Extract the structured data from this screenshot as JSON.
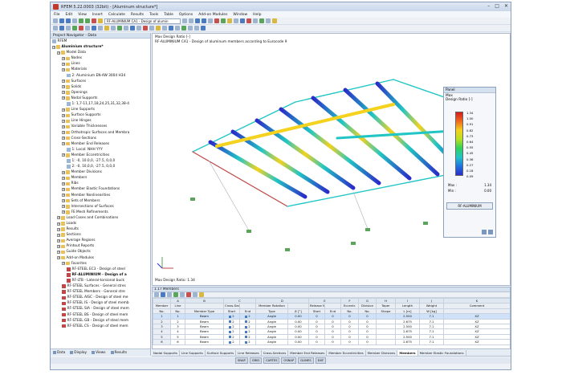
{
  "window": {
    "title": "RFEM 5.22.0003 (32bit) - [Aluminum structure*]"
  },
  "menu": [
    "File",
    "Edit",
    "View",
    "Insert",
    "Calculate",
    "Results",
    "Tools",
    "Table",
    "Options",
    "Add-on Modules",
    "Window",
    "Help"
  ],
  "toolbar": {
    "module_combo": "RF-ALUMINIUM CA1 - Design of alumin"
  },
  "navigator": {
    "header": "Project Navigator - Data",
    "items": [
      {
        "label": "RFEM",
        "level": 0,
        "type": "file"
      },
      {
        "label": "Aluminium structure*",
        "level": 0,
        "type": "folder",
        "bold": true
      },
      {
        "label": "Model Data",
        "level": 1,
        "type": "folder"
      },
      {
        "label": "Nodes",
        "level": 2,
        "type": "folder"
      },
      {
        "label": "Lines",
        "level": 2,
        "type": "folder"
      },
      {
        "label": "Materials",
        "level": 2,
        "type": "folder"
      },
      {
        "label": "2: Aluminium EN-AW 3004 H34",
        "level": 3,
        "type": "file"
      },
      {
        "label": "Surfaces",
        "level": 2,
        "type": "folder"
      },
      {
        "label": "Solids",
        "level": 2,
        "type": "folder"
      },
      {
        "label": "Openings",
        "level": 2,
        "type": "folder"
      },
      {
        "label": "Nodal Supports",
        "level": 2,
        "type": "folder"
      },
      {
        "label": "1: 1,7-11,17,18,24,25,31,32,38-4",
        "level": 3,
        "type": "file"
      },
      {
        "label": "Line Supports",
        "level": 2,
        "type": "folder"
      },
      {
        "label": "Surface Supports",
        "level": 2,
        "type": "folder"
      },
      {
        "label": "Line Hinges",
        "level": 2,
        "type": "folder"
      },
      {
        "label": "Variable Thicknesses",
        "level": 2,
        "type": "folder"
      },
      {
        "label": "Orthotropic Surfaces and Membra",
        "level": 2,
        "type": "folder"
      },
      {
        "label": "Cross-Sections",
        "level": 2,
        "type": "folder"
      },
      {
        "label": "Member End Releases",
        "level": 2,
        "type": "folder"
      },
      {
        "label": "1: Local: NHH YYY",
        "level": 3,
        "type": "file"
      },
      {
        "label": "Member Eccentricities",
        "level": 2,
        "type": "folder"
      },
      {
        "label": "1: -0, 10.0,0, -27.5, 0,0,0",
        "level": 3,
        "type": "file"
      },
      {
        "label": "2: -0, 10,0,0, -27.5, 0,0,0",
        "level": 3,
        "type": "file"
      },
      {
        "label": "Member Divisions",
        "level": 2,
        "type": "folder"
      },
      {
        "label": "Members",
        "level": 2,
        "type": "folder"
      },
      {
        "label": "Ribs",
        "level": 2,
        "type": "folder"
      },
      {
        "label": "Member Elastic Foundations",
        "level": 2,
        "type": "folder"
      },
      {
        "label": "Member Nonlinearities",
        "level": 2,
        "type": "folder"
      },
      {
        "label": "Sets of Members",
        "level": 2,
        "type": "folder"
      },
      {
        "label": "Intersections of Surfaces",
        "level": 2,
        "type": "folder"
      },
      {
        "label": "FE Mesh Refinements",
        "level": 2,
        "type": "folder"
      },
      {
        "label": "Load Cases and Combinations",
        "level": 1,
        "type": "folder"
      },
      {
        "label": "Loads",
        "level": 1,
        "type": "folder"
      },
      {
        "label": "Results",
        "level": 1,
        "type": "folder"
      },
      {
        "label": "Sections",
        "level": 1,
        "type": "folder"
      },
      {
        "label": "Average Regions",
        "level": 1,
        "type": "folder"
      },
      {
        "label": "Printout Reports",
        "level": 1,
        "type": "folder"
      },
      {
        "label": "Guide Objects",
        "level": 1,
        "type": "folder"
      },
      {
        "label": "Add-on Modules",
        "level": 1,
        "type": "folder"
      },
      {
        "label": "Favorites",
        "level": 2,
        "type": "folder"
      },
      {
        "label": "RF-STEEL EC3 - Design of steel",
        "level": 3,
        "type": "mod"
      },
      {
        "label": "RF-ALUMINIUM - Design of a",
        "level": 3,
        "type": "mod",
        "bold": true
      },
      {
        "label": "RF-LTB - Lateral-torsional buck",
        "level": 3,
        "type": "mod"
      },
      {
        "label": "RF-STEEL Surfaces - General stres",
        "level": 2,
        "type": "mod"
      },
      {
        "label": "RF-STEEL Members - General stre",
        "level": 2,
        "type": "mod"
      },
      {
        "label": "RF-STEEL AISC - Design of steel me",
        "level": 2,
        "type": "mod"
      },
      {
        "label": "RF-STEEL IS - Design of steel memb",
        "level": 2,
        "type": "mod"
      },
      {
        "label": "RF-STEEL SIA - Design of steel mem",
        "level": 2,
        "type": "mod"
      },
      {
        "label": "RF-STEEL BS - Design of steel mem",
        "level": 2,
        "type": "mod"
      },
      {
        "label": "RF-STEEL GB - Design of steel mem",
        "level": 2,
        "type": "mod"
      },
      {
        "label": "RF-STEEL CS - Design of steel mem",
        "level": 2,
        "type": "mod"
      }
    ],
    "bottom_tabs": [
      "Data",
      "Display",
      "Views",
      "Results"
    ]
  },
  "viewport": {
    "line1": "Max Design Ratio [-]",
    "line2": "RF-ALUMINIUM CA1 - Design of aluminum members according to Eurocode 9",
    "bottom": "Max Design Ratio: 1.34"
  },
  "panel": {
    "title": "Panel",
    "sub1": "Max",
    "sub2": "Design Ratio [-]",
    "ticks": [
      "1.34",
      "1.00",
      "0.91",
      "0.82",
      "0.73",
      "0.64",
      "0.55",
      "0.45",
      "0.36",
      "0.27",
      "0.18",
      "0.09"
    ],
    "max_label": "Max :",
    "max_value": "1.34",
    "min_label": "Min :",
    "min_value": "0.00",
    "button": "RF-ALUMINIUM"
  },
  "table": {
    "title": "1.17 Members",
    "letters": [
      "A",
      "B",
      "C",
      "D",
      "E",
      "F",
      "G",
      "H",
      "I",
      "J",
      "K",
      "L",
      "M"
    ],
    "head1": [
      "Member",
      "Line",
      "",
      "Cross-Section No.",
      "",
      "Member Rotation",
      "",
      "Release No.",
      "",
      "Eccentr.",
      "Division",
      "Taper",
      "Length",
      "Weight",
      "Comment"
    ],
    "head2": [
      "No.",
      "No.",
      "Member Type",
      "Start",
      "End",
      "Type",
      "β [°]",
      "Start",
      "End",
      "No.",
      "No.",
      "Shape",
      "L [m]",
      "W [kg]",
      ""
    ],
    "rows": [
      [
        "1",
        "1",
        "Beam",
        "2",
        "2",
        "Angle",
        "0.00",
        "0",
        "0",
        "0",
        "0",
        "",
        "2.500",
        "7.1",
        "XZ"
      ],
      [
        "2",
        "2",
        "Beam",
        "2",
        "2",
        "Angle",
        "0.00",
        "0",
        "0",
        "0",
        "0",
        "",
        "2.675",
        "7.1",
        "XZ"
      ],
      [
        "3",
        "3",
        "Beam",
        "2",
        "2",
        "Angle",
        "0.00",
        "0",
        "0",
        "0",
        "0",
        "",
        "2.500",
        "7.1",
        "XZ"
      ],
      [
        "4",
        "4",
        "Beam",
        "2",
        "2",
        "Angle",
        "0.00",
        "0",
        "0",
        "0",
        "0",
        "",
        "2.675",
        "7.1",
        "XZ"
      ],
      [
        "5",
        "5",
        "Beam",
        "2",
        "2",
        "Angle",
        "0.00",
        "0",
        "0",
        "0",
        "0",
        "",
        "2.500",
        "7.1",
        "XZ"
      ],
      [
        "6",
        "6",
        "Beam",
        "2",
        "2",
        "Angle",
        "0.00",
        "0",
        "0",
        "0",
        "0",
        "",
        "2.675",
        "7.1",
        "XZ"
      ]
    ]
  },
  "bottom_tabs": [
    "Nodal Supports",
    "Line Supports",
    "Surface Supports",
    "Line Releases",
    "Cross-Sections",
    "Member End Releases",
    "Member Eccentricities",
    "Member Divisions",
    "Members",
    "Member Elastic Foundations"
  ],
  "active_tab": "Members",
  "statusbar": [
    "SNAP",
    "GRID",
    "CARTES",
    "OSNAP",
    "GLINES",
    "DXF"
  ],
  "colors": {
    "accent": "#3399ff",
    "high": "#d61c1c",
    "mid": "#f4d21e",
    "low": "#2b2bc8"
  }
}
